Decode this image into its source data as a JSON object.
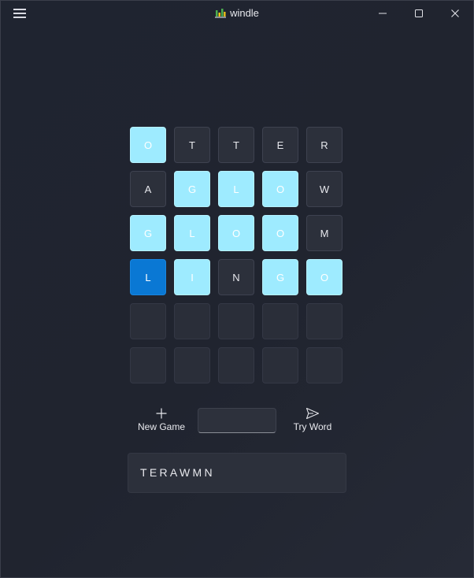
{
  "window": {
    "title": "windle",
    "logo_icon": "bar-chart-logo-icon",
    "menu_icon": "hamburger-menu-icon",
    "controls": [
      "minimize-icon",
      "maximize-icon",
      "close-icon"
    ]
  },
  "board": {
    "rows": [
      [
        {
          "letter": "O",
          "state": "hit"
        },
        {
          "letter": "T",
          "state": "absent"
        },
        {
          "letter": "T",
          "state": "absent"
        },
        {
          "letter": "E",
          "state": "absent"
        },
        {
          "letter": "R",
          "state": "absent"
        }
      ],
      [
        {
          "letter": "A",
          "state": "absent"
        },
        {
          "letter": "G",
          "state": "hit"
        },
        {
          "letter": "L",
          "state": "hit"
        },
        {
          "letter": "O",
          "state": "hit"
        },
        {
          "letter": "W",
          "state": "absent"
        }
      ],
      [
        {
          "letter": "G",
          "state": "hit"
        },
        {
          "letter": "L",
          "state": "hit"
        },
        {
          "letter": "O",
          "state": "hit"
        },
        {
          "letter": "O",
          "state": "hit"
        },
        {
          "letter": "M",
          "state": "absent"
        }
      ],
      [
        {
          "letter": "L",
          "state": "sel"
        },
        {
          "letter": "I",
          "state": "hit"
        },
        {
          "letter": "N",
          "state": "absent"
        },
        {
          "letter": "G",
          "state": "hit"
        },
        {
          "letter": "O",
          "state": "hit"
        }
      ],
      [
        {
          "letter": "",
          "state": "empty"
        },
        {
          "letter": "",
          "state": "empty"
        },
        {
          "letter": "",
          "state": "empty"
        },
        {
          "letter": "",
          "state": "empty"
        },
        {
          "letter": "",
          "state": "empty"
        }
      ],
      [
        {
          "letter": "",
          "state": "empty"
        },
        {
          "letter": "",
          "state": "empty"
        },
        {
          "letter": "",
          "state": "empty"
        },
        {
          "letter": "",
          "state": "empty"
        },
        {
          "letter": "",
          "state": "empty"
        }
      ]
    ]
  },
  "actions": {
    "new_game_label": "New Game",
    "new_game_icon": "plus-icon",
    "try_word_label": "Try Word",
    "try_word_icon": "send-icon",
    "word_input_value": "",
    "word_input_placeholder": ""
  },
  "excluded_letters": "TERAWMN",
  "colors": {
    "background": "#20242f",
    "hit": "#9eebff",
    "selected": "#0a78d4",
    "absent": "#2c303b"
  }
}
